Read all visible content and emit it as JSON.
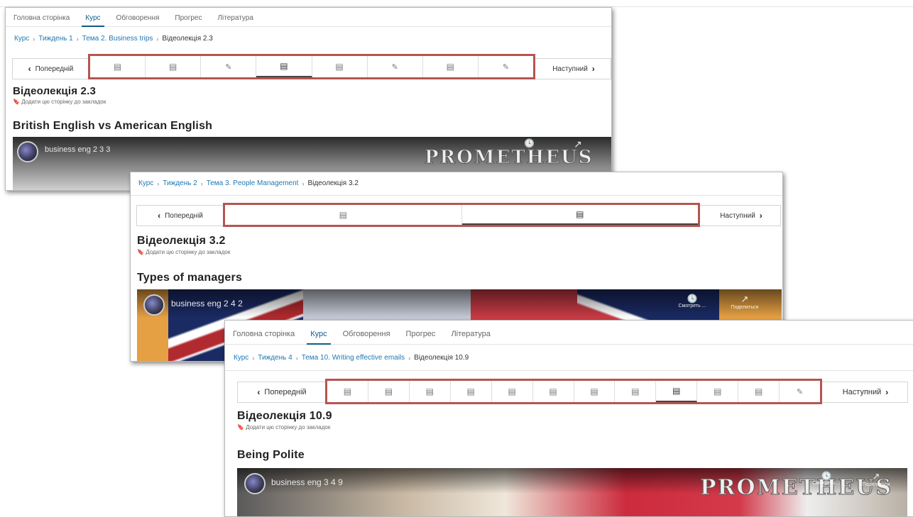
{
  "panel1": {
    "tabs": [
      "Головна сторінка",
      "Курс",
      "Обговорення",
      "Прогрес",
      "Література"
    ],
    "active_tab": "Курс",
    "breadcrumb": {
      "course": "Курс",
      "week": "Тиждень 1",
      "topic": "Тема 2. Business trips",
      "current": "Відеолекція 2.3"
    },
    "prev_label": "Попередній",
    "next_label": "Наступний",
    "sequence_icons": [
      "film-icon",
      "film-icon",
      "edit-icon",
      "film-icon",
      "film-icon",
      "edit-icon",
      "film-icon",
      "edit-icon"
    ],
    "page_title": "Відеолекція 2.3",
    "bookmark": "Додати цю сторінку до закладок",
    "video_heading": "British English vs American English",
    "video_label": "business eng 2 3 3",
    "logo": "PROMETHEUS"
  },
  "panel2": {
    "breadcrumb": {
      "course": "Курс",
      "week": "Тиждень 2",
      "topic": "Тема 3. People Management",
      "current": "Відеолекція 3.2"
    },
    "prev_label": "Попередній",
    "next_label": "Наступний",
    "sequence_icons": [
      "film-icon",
      "film-icon"
    ],
    "page_title": "Відеолекція 3.2",
    "bookmark": "Додати цю сторінку до закладок",
    "video_heading": "Types of managers",
    "video_label": "business eng 2 4 2",
    "watch_later": "Смотреть ...",
    "share": "Поделиться"
  },
  "panel3": {
    "tabs": [
      "Головна сторінка",
      "Курс",
      "Обговорення",
      "Прогрес",
      "Література"
    ],
    "active_tab": "Курс",
    "breadcrumb": {
      "course": "Курс",
      "week": "Тиждень 4",
      "topic": "Тема 10. Writing effective emails",
      "current": "Відеолекція 10.9"
    },
    "prev_label": "Попередній",
    "next_label": "Наступний",
    "sequence_icons": [
      "film-icon",
      "film-icon",
      "film-icon",
      "film-icon",
      "film-icon",
      "film-icon",
      "film-icon",
      "film-icon",
      "film-icon",
      "film-icon",
      "film-icon",
      "edit-icon"
    ],
    "page_title": "Відеолекція 10.9",
    "bookmark": "Додати цю сторінку до закладок",
    "video_heading": "Being Polite",
    "video_label": "business eng 3 4 9",
    "logo": "PROMETHEUS",
    "watch_later": "Смотреть ...",
    "share": "Поделиться"
  },
  "colors": {
    "highlight": "#b55550",
    "link": "#1f77b4",
    "active_tab": "#0f5d8a"
  }
}
